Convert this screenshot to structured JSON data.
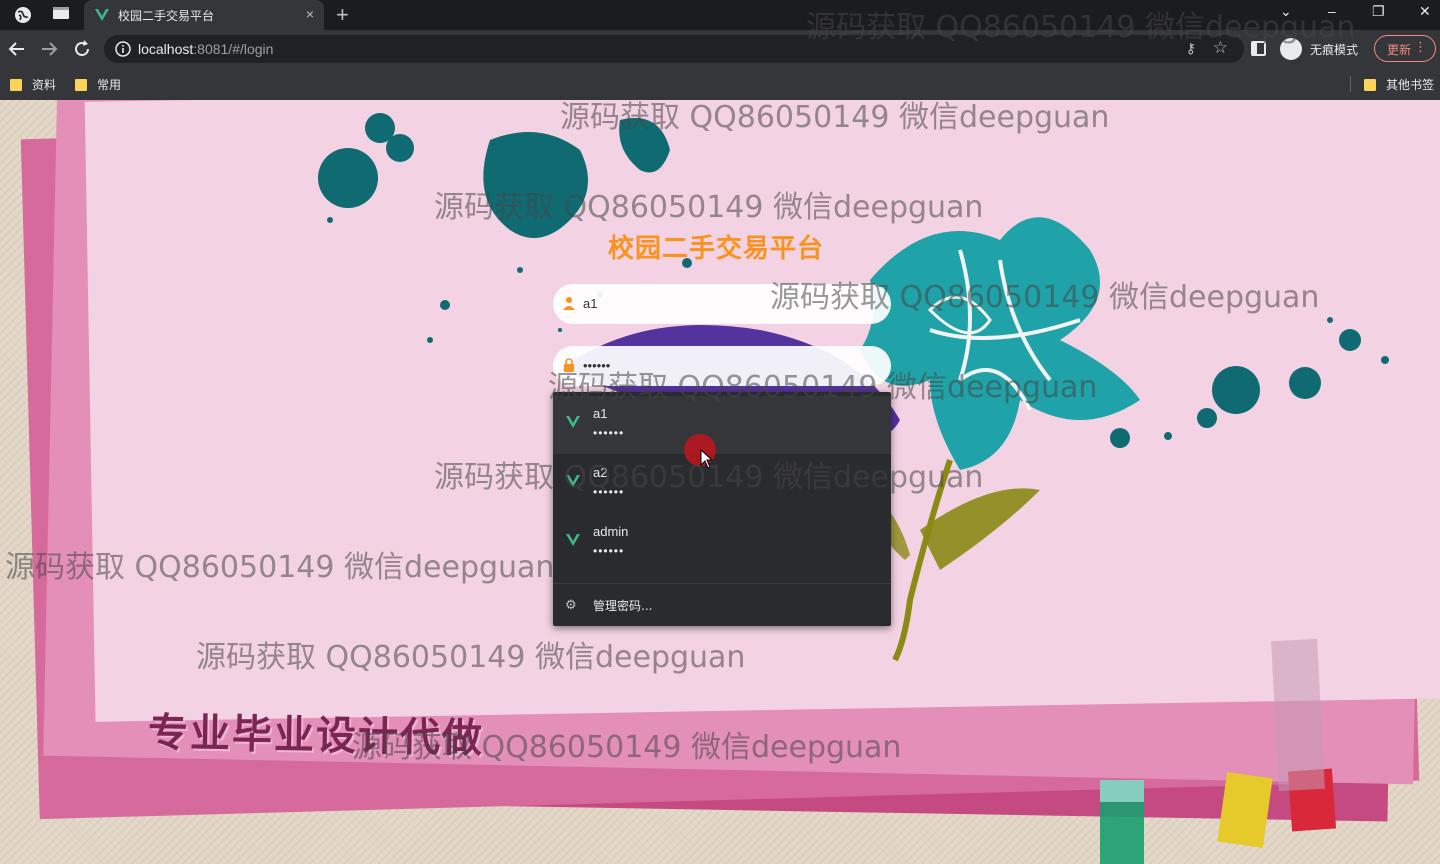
{
  "browser": {
    "tab_title": "校园二手交易平台",
    "tab_close_glyph": "×",
    "new_tab_glyph": "+",
    "window_controls": {
      "minimize": "–",
      "maximize": "❐",
      "close": "✕",
      "tab_search": "⌄"
    },
    "url_host": "localhost",
    "url_rest": ":8081/#/login",
    "incognito_label": "无痕模式",
    "update_label": "更新",
    "bookmarks": [
      "资料",
      "常用"
    ],
    "other_bookmarks": "其他书签"
  },
  "page": {
    "login_title": "校园二手交易平台",
    "username_value": "a1",
    "password_value": "••••••",
    "slogan": "专业毕业设计代做"
  },
  "autofill": {
    "items": [
      {
        "username": "a1",
        "password": "••••••"
      },
      {
        "username": "a2",
        "password": "••••••"
      },
      {
        "username": "admin",
        "password": "••••••"
      }
    ],
    "manage_label": "管理密码..."
  },
  "watermark_text": "源码获取 QQ86050149 微信deepguan",
  "colors": {
    "accent_orange": "#f7931e",
    "vue_green": "#41b883",
    "update_red": "#f28b82"
  }
}
